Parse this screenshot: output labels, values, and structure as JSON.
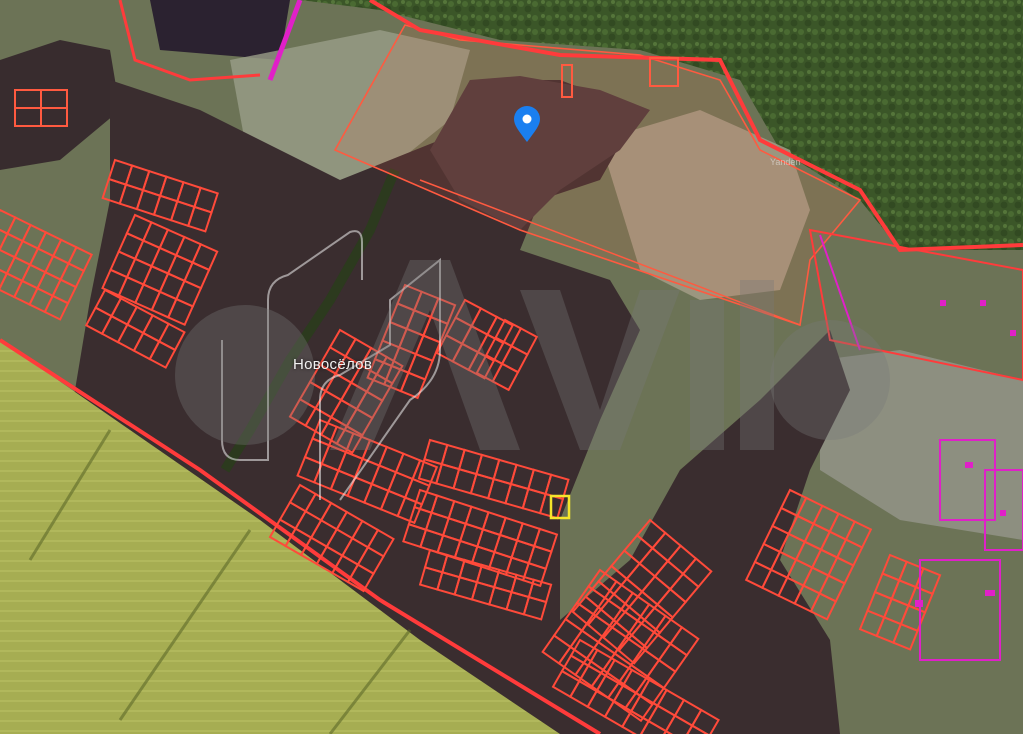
{
  "map": {
    "place_label": "Новосёлов",
    "tiny_label": "Yanden",
    "watermark_brand": "Avito",
    "colors": {
      "parcel_outline": "#ff4a3a",
      "selected_parcel": "#f5e52a",
      "boundary_line": "#ff3b3b",
      "building_magenta": "#e020c8",
      "pin_blue": "#1a7ff0",
      "forest": "#3e5a2a",
      "field_yellow": "#a7b052",
      "plowed_soil": "#3a2e2e"
    },
    "icons": [
      "location-pin-icon",
      "avito-watermark-logo"
    ]
  }
}
